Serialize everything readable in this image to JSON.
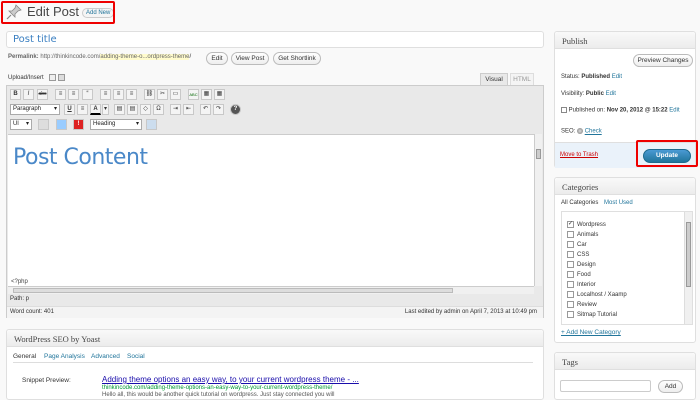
{
  "header": {
    "title": "Edit Post",
    "add_new": "Add New"
  },
  "post": {
    "title": "Post title",
    "permalink_label": "Permalink:",
    "permalink_base": "http://thinkincode.com/",
    "permalink_slug": "adding-theme-o...ordpress-theme",
    "permalink_end": "/",
    "edit_btn": "Edit",
    "view_btn": "View Post",
    "shortlink_btn": "Get Shortlink"
  },
  "editor": {
    "upload_label": "Upload/Insert",
    "tab_visual": "Visual",
    "tab_html": "HTML",
    "paragraph": "Paragraph",
    "ul": "Ul",
    "heading": "Heading",
    "content": "Post Content",
    "php_tag": "<?php",
    "path": "Path: p",
    "word_count": "Word count: 401",
    "last_edited": "Last edited by admin on April 7, 2013 at 10:49 pm",
    "row1": [
      "B",
      "I",
      "abc",
      "≡",
      "≡",
      "“",
      "≡",
      "≡",
      "≡",
      "⛓",
      "✂",
      "▭",
      "ABC",
      "▦",
      "▦"
    ],
    "row2": [
      "U",
      "≡",
      "A",
      "▾",
      "▤",
      "▤",
      "◇",
      "Ω",
      "⇥",
      "⇤",
      "↶",
      "↷",
      "?"
    ]
  },
  "seo": {
    "title": "WordPress SEO by Yoast",
    "tabs": [
      "General",
      "Page Analysis",
      "Advanced",
      "Social"
    ],
    "snippet_label": "Snippet Preview:",
    "snippet_title": "Adding theme options an easy way, to your current wordpress theme - ...",
    "snippet_url": "thinkincode.com/adding-theme-options-an-easy-way-to-your-current-wordpress-theme/",
    "snippet_desc": "Hello all, this would be another quick tutorial on wordpress. Just stay connected you will"
  },
  "publish": {
    "title": "Publish",
    "preview_btn": "Preview Changes",
    "status_label": "Status:",
    "status_value": "Published",
    "visibility_label": "Visibility:",
    "visibility_value": "Public",
    "published_label": "Published on:",
    "published_value": "Nov 20, 2012 @ 15:22",
    "edit": "Edit",
    "seo_label": "SEO:",
    "check": "Check",
    "trash": "Move to Trash",
    "update": "Update"
  },
  "categories": {
    "title": "Categories",
    "tab_all": "All Categories",
    "tab_used": "Most Used",
    "items": [
      {
        "label": "Wordpress",
        "checked": "✓"
      },
      {
        "label": "Animals",
        "checked": ""
      },
      {
        "label": "Car",
        "checked": ""
      },
      {
        "label": "CSS",
        "checked": ""
      },
      {
        "label": "Design",
        "checked": ""
      },
      {
        "label": "Food",
        "checked": ""
      },
      {
        "label": "Interior",
        "checked": ""
      },
      {
        "label": "Localhost / Xaamp",
        "checked": ""
      },
      {
        "label": "Review",
        "checked": ""
      },
      {
        "label": "Sitmap Tutorial",
        "checked": ""
      }
    ],
    "add_new": "+ Add New Category"
  },
  "tags": {
    "title": "Tags",
    "add_btn": "Add"
  },
  "colors": {
    "accent": "#21759b",
    "update_bg": "#2a7ab5",
    "highlight": "#e00000"
  }
}
